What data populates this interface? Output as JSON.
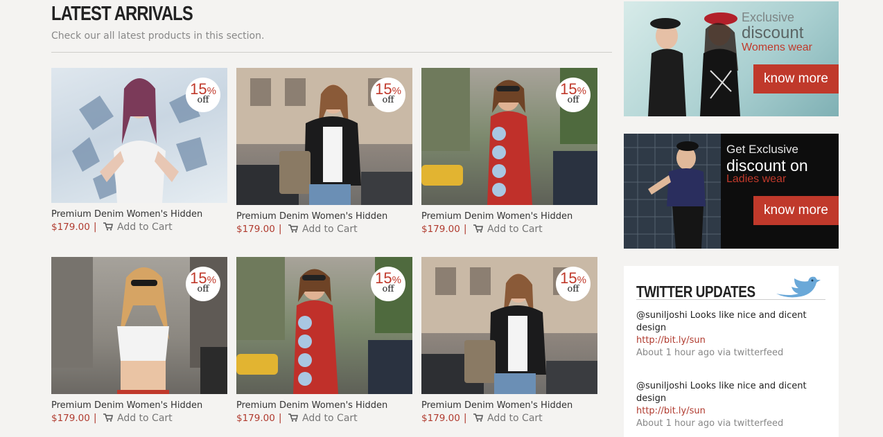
{
  "section": {
    "title": "LATEST ARRIVALS",
    "subtitle": "Check our all latest products in this section."
  },
  "products": [
    {
      "name": "Premium Denim Women's Hidden",
      "price": "$179.00",
      "cart_label": "Add to Cart",
      "discount_value": "15",
      "discount_unit": "%",
      "discount_off": "off"
    },
    {
      "name": "Premium Denim Women's Hidden",
      "price": "$179.00",
      "cart_label": "Add to Cart",
      "discount_value": "15",
      "discount_unit": "%",
      "discount_off": "off"
    },
    {
      "name": "Premium Denim Women's Hidden",
      "price": "$179.00",
      "cart_label": "Add to Cart",
      "discount_value": "15",
      "discount_unit": "%",
      "discount_off": "off"
    },
    {
      "name": "Premium Denim Women's Hidden",
      "price": "$179.00",
      "cart_label": "Add to Cart",
      "discount_value": "15",
      "discount_unit": "%",
      "discount_off": "off"
    },
    {
      "name": "Premium Denim Women's Hidden",
      "price": "$179.00",
      "cart_label": "Add to Cart",
      "discount_value": "15",
      "discount_unit": "%",
      "discount_off": "off"
    },
    {
      "name": "Premium Denim Women's Hidden",
      "price": "$179.00",
      "cart_label": "Add to Cart",
      "discount_value": "15",
      "discount_unit": "%",
      "discount_off": "off"
    }
  ],
  "separator": "|",
  "promos": [
    {
      "line1": "Exclusive",
      "line2": "discount",
      "line3": "Womens wear",
      "cta": "know more"
    },
    {
      "line1": "Get Exclusive",
      "line2": "discount on",
      "line3": "Ladies wear",
      "cta": "know more"
    }
  ],
  "twitter": {
    "title": "TWITTER UPDATES",
    "icon": "twitter-bird-icon",
    "tweets": [
      {
        "text": "@suniljoshi Looks like nice and dicent design",
        "link": "http://bit.ly/sun",
        "time": "About 1 hour ago via twitterfeed"
      },
      {
        "text": "@suniljoshi Looks like nice and dicent design",
        "link": "http://bit.ly/sun",
        "time": "About 1 hour ago via twitterfeed"
      }
    ]
  },
  "colors": {
    "accent": "#c0392b",
    "price": "#b03a2e",
    "background": "#f4f3f1"
  }
}
